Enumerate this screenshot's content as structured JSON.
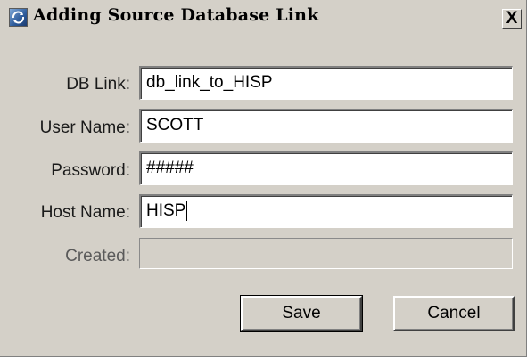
{
  "window": {
    "title": "Adding Source Database Link",
    "close_glyph": "X"
  },
  "form": {
    "db_link": {
      "label": "DB Link:",
      "value": "db_link_to_HISP"
    },
    "user_name": {
      "label": "User Name:",
      "value": "SCOTT"
    },
    "password": {
      "label": "Password:",
      "value": "#####"
    },
    "host_name": {
      "label": "Host Name:",
      "value": "HISP"
    },
    "created": {
      "label": "Created:",
      "value": ""
    }
  },
  "buttons": {
    "save": "Save",
    "cancel": "Cancel"
  },
  "icons": {
    "app": "app-window-icon",
    "close": "close-icon"
  }
}
